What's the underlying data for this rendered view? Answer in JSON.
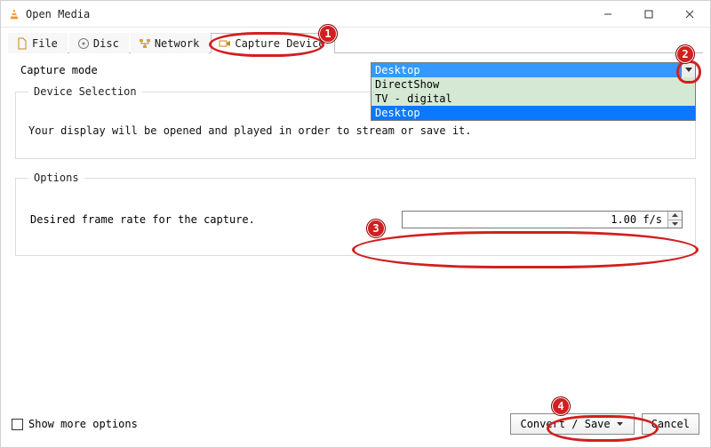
{
  "window_title": "Open Media",
  "tabs": {
    "file": "File",
    "disc": "Disc",
    "network": "Network",
    "capture": "Capture Device"
  },
  "capture_mode_label": "Capture mode",
  "dropdown": {
    "selected": "Desktop",
    "options": [
      "DirectShow",
      "TV - digital",
      "Desktop"
    ]
  },
  "device_section_title": "Device Selection",
  "device_msg": "Your display will be opened and played in order to stream or save it.",
  "options_section_title": "Options",
  "frame_rate_label": "Desired frame rate for the capture.",
  "frame_rate_value": "1.00 f/s",
  "show_more": "Show more options",
  "buttons": {
    "convert": "Convert / Save",
    "cancel": "Cancel"
  },
  "badges": [
    "1",
    "2",
    "3",
    "4"
  ]
}
